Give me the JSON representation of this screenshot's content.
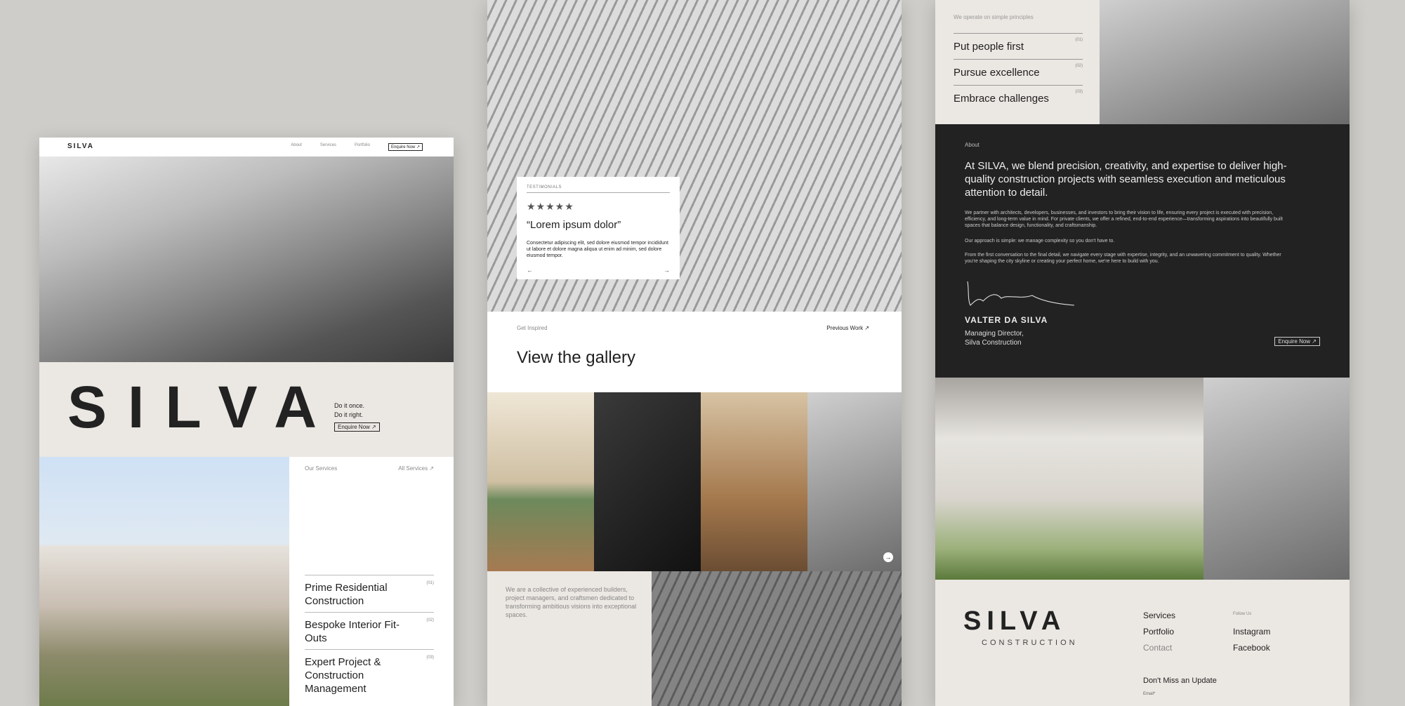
{
  "panel1": {
    "nav": {
      "logo": "SILVA",
      "links": [
        "About",
        "Services",
        "Portfolio"
      ],
      "cta": "Enquire Now ↗"
    },
    "hero": {
      "brand": "SILVA",
      "tagline_1": "Do it once.",
      "tagline_2": "Do it right.",
      "cta": "Enquire Now ↗"
    },
    "services": {
      "heading": "Our Services",
      "all_link": "All Services ↗",
      "items": [
        {
          "label": "Prime Residential Construction",
          "num": "(01)"
        },
        {
          "label": "Bespoke Interior Fit-Outs",
          "num": "(02)"
        },
        {
          "label": "Expert Project & Construction Management",
          "num": "(03)"
        }
      ]
    }
  },
  "panel2": {
    "testimonial": {
      "label": "TESTIMONIALS",
      "stars": "★★★★★",
      "quote": "“Lorem ipsum dolor”",
      "body": "Consectetur adipiscing elit, sed dolore eiusmod tempor incididunt ut labore et dolore magna aliqua ut enim ad minim, sed dolore eiusmod tempor.",
      "prev_arrow": "←",
      "next_arrow": "→"
    },
    "gallery": {
      "eyebrow": "Get Inspired",
      "prev_link": "Previous Work ↗",
      "title": "View the gallery",
      "next_arrow": "→"
    },
    "collective": "We are a collective of experienced builders, project managers, and craftsmen dedicated to transforming ambitious visions into exceptional spaces."
  },
  "panel3": {
    "principles": {
      "heading": "We operate on simple principles",
      "items": [
        {
          "label": "Put people first",
          "num": "(01)"
        },
        {
          "label": "Pursue excellence",
          "num": "(02)"
        },
        {
          "label": "Embrace challenges",
          "num": "(03)"
        }
      ]
    },
    "about": {
      "label": "About",
      "lead": "At SILVA, we blend precision, creativity, and expertise to deliver high-quality construction projects with seamless execution and meticulous attention to detail.",
      "p1": "We partner with architects, developers, businesses, and investors to bring their vision to life, ensuring every project is executed with precision, efficiency, and long-term value in mind. For private clients, we offer a refined, end-to-end experience—transforming aspirations into beautifully built spaces that balance design, functionality, and craftsmanship.",
      "p2": "Our approach is simple: we manage complexity so you don't have to.",
      "p3": "From the first conversation to the final detail, we navigate every stage with expertise, integrity, and an unwavering commitment to quality. Whether you're shaping the city skyline or creating your perfect home, we're here to build with you.",
      "name": "VALTER DA SILVA",
      "role_1": "Managing Director,",
      "role_2": "Silva Construction",
      "cta": "Enquire Now ↗"
    },
    "footer": {
      "brand": "SILVA",
      "brand_sub": "CONSTRUCTION",
      "links": [
        "Services",
        "Portfolio",
        "Contact"
      ],
      "follow_label": "Follow Us",
      "social": [
        "Instagram",
        "Facebook"
      ],
      "newsletter": "Don't Miss an Update",
      "email_label": "Email*"
    }
  }
}
